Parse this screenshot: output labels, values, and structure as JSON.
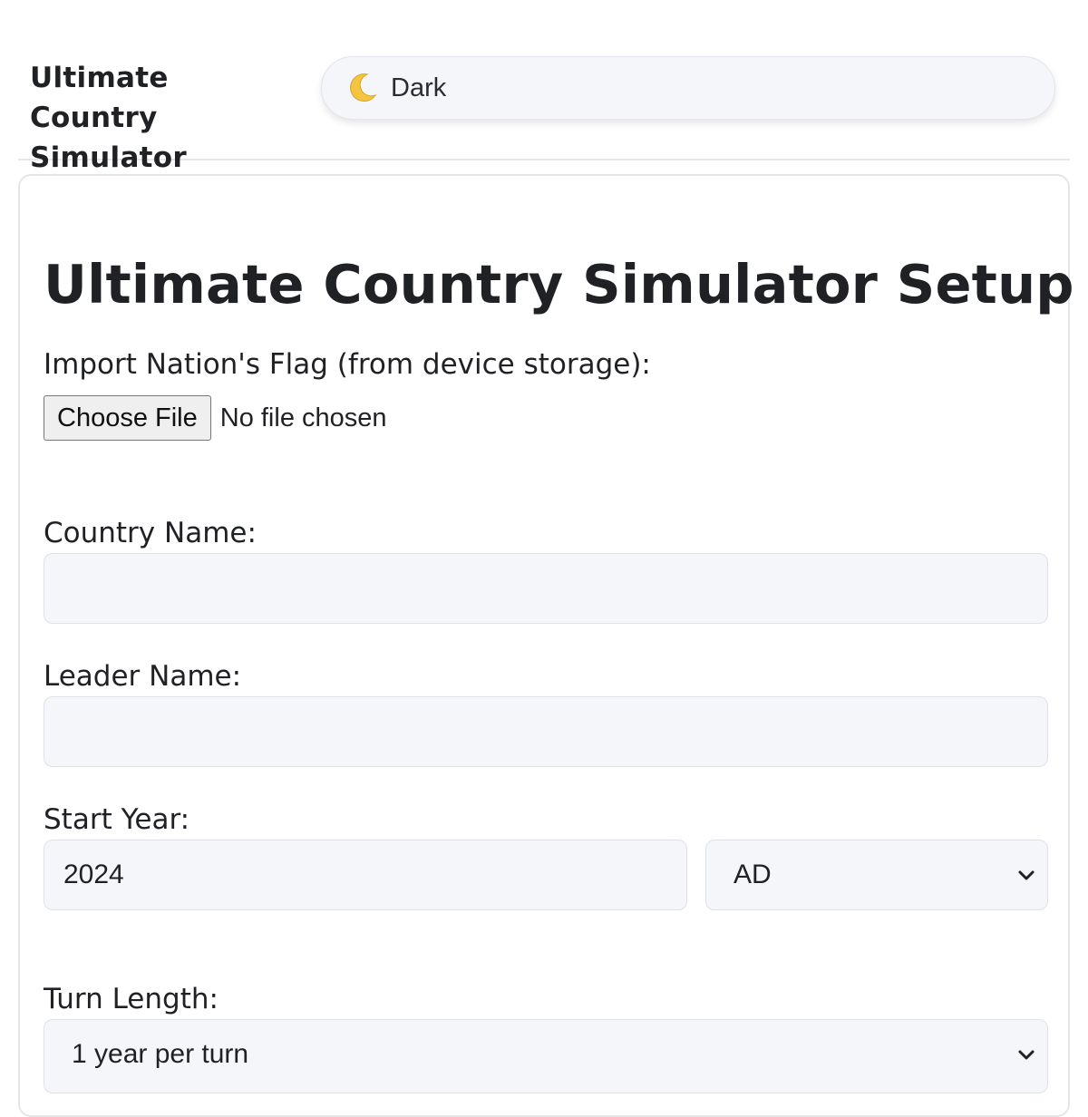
{
  "header": {
    "app_title": "Ultimate Country Simulator",
    "theme_toggle": {
      "icon": "crescent-moon-icon",
      "label": "Dark"
    }
  },
  "setup": {
    "title": "Ultimate Country Simulator Setup",
    "flag_import": {
      "label": "Import Nation's Flag (from device storage):",
      "button_label": "Choose File",
      "status": "No file chosen"
    },
    "country_name": {
      "label": "Country Name:",
      "value": ""
    },
    "leader_name": {
      "label": "Leader Name:",
      "value": ""
    },
    "start_year": {
      "label": "Start Year:",
      "value": "2024",
      "era_selected": "AD"
    },
    "turn_length": {
      "label": "Turn Length:",
      "selected": "1 year per turn"
    }
  },
  "colors": {
    "field_background": "#f4f6fa",
    "border": "#e4e6ea",
    "text": "#1f2124",
    "moon": "#f5c542"
  }
}
